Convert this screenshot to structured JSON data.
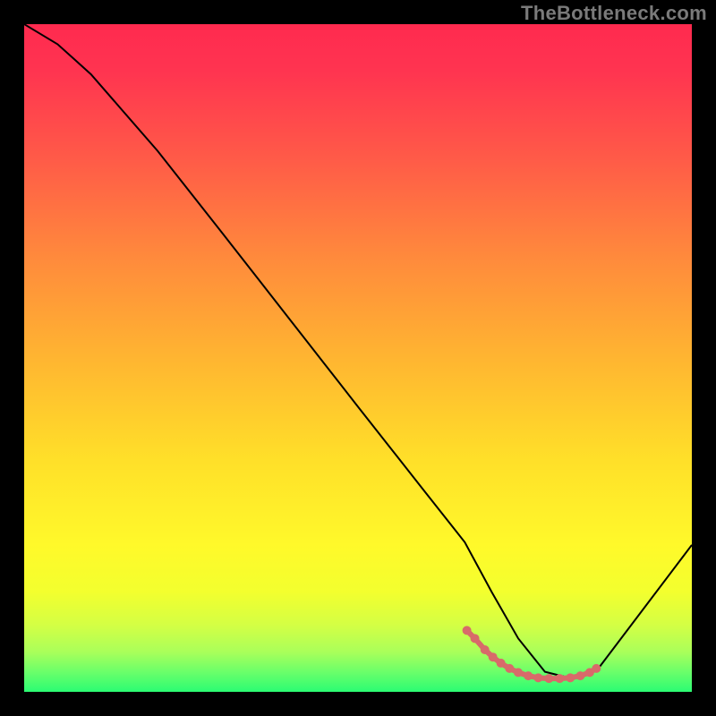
{
  "watermark": "TheBottleneck.com",
  "chart_data": {
    "type": "line",
    "title": "",
    "xlabel": "",
    "ylabel": "",
    "xlim": [
      0,
      100
    ],
    "ylim": [
      0,
      100
    ],
    "grid": false,
    "series": [
      {
        "name": "bottleneck-curve",
        "x": [
          0,
          5,
          10,
          20,
          30,
          40,
          50,
          60,
          66,
          70,
          74,
          78,
          82,
          86,
          100
        ],
        "y": [
          100,
          97,
          92.5,
          81,
          68.3,
          55.5,
          42.7,
          30,
          22.4,
          15,
          8,
          3,
          2,
          3.5,
          22
        ]
      }
    ],
    "markers": {
      "name": "bottleneck-markers",
      "x": [
        66.3,
        67.5,
        69.0,
        70.2,
        71.4,
        72.7,
        74.0,
        75.5,
        77.0,
        78.6,
        80.2,
        81.8,
        83.3,
        84.7,
        85.7
      ],
      "y": [
        9.2,
        8.0,
        6.3,
        5.2,
        4.3,
        3.5,
        2.9,
        2.4,
        2.1,
        2.0,
        2.0,
        2.1,
        2.4,
        2.9,
        3.5
      ]
    },
    "gradient_stops": [
      {
        "offset": 0.0,
        "color": "#ff2a4f"
      },
      {
        "offset": 0.07,
        "color": "#ff3450"
      },
      {
        "offset": 0.2,
        "color": "#ff5a48"
      },
      {
        "offset": 0.35,
        "color": "#ff8a3c"
      },
      {
        "offset": 0.5,
        "color": "#ffb531"
      },
      {
        "offset": 0.65,
        "color": "#ffdf29"
      },
      {
        "offset": 0.78,
        "color": "#fff92a"
      },
      {
        "offset": 0.85,
        "color": "#f3ff2e"
      },
      {
        "offset": 0.9,
        "color": "#d4ff44"
      },
      {
        "offset": 0.94,
        "color": "#aaff5a"
      },
      {
        "offset": 0.97,
        "color": "#6bff6a"
      },
      {
        "offset": 1.0,
        "color": "#2bfc73"
      }
    ],
    "marker_color": "#d86a6a",
    "curve_color": "#000000"
  }
}
